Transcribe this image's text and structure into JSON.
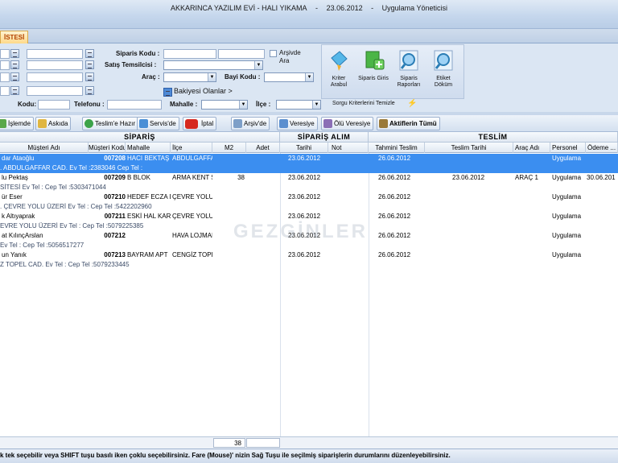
{
  "titlebar": {
    "company": "AKKARINCA YAZILIM EVİ - HALI YIKAMA",
    "sep1": "-",
    "date": "23.06.2012",
    "sep2": "-",
    "user": "Uygulama Yöneticisi"
  },
  "tab": {
    "label": "İSTESİ"
  },
  "filters": {
    "siparis_kodu": "Siparis Kodu :",
    "satis_temsilcisi": "Satış Temsilcisi :",
    "arac": "Araç :",
    "bayi_kodu": "Bayi Kodu :",
    "arsivde_ara": "Arşivde",
    "arsivde_ara2": "Ara",
    "bakiyesi_olanlar": "Bakiyesi Olanlar >",
    "kodu": "Kodu:",
    "telefonu": "Telefonu :",
    "mahalle": "Mahalle :",
    "ilce": "İlçe :",
    "sorgu_temizle": "Sorgu Kriterlerini Temizle"
  },
  "bigbuttons": {
    "kriter": "Kriter Arabul",
    "siparis_giris": "Siparis Giris",
    "siparis_raporlari": "Siparis Raporları",
    "etiket_dokum": "Etiket Döküm"
  },
  "toolbar": {
    "islemde": "İşlemde",
    "askida": "Askıda",
    "teslime_hazir": "Teslim'e Hazır",
    "servisde": "Servis'de",
    "iptal": "İptal",
    "arsivde": "Arşiv'de",
    "veresiye": "Veresiye",
    "olu_veresiye": "Ölü Veresiye",
    "aktiflerin_tumu": "Aktiflerin Tümü"
  },
  "grid": {
    "group_siparis": "SİPARİŞ",
    "group_alim": "SİPARİŞ ALIM",
    "group_teslim": "TESLİM",
    "columns": {
      "musteri_adi": "Müşteri Adı",
      "musteri_kodu": "Müşteri Kodu",
      "mahalle": "Mahalle",
      "ilce": "İlçe",
      "m2": "M2",
      "adet": "Adet",
      "tarih": "Tarihi",
      "not": "Not",
      "tahmini_teslim": "Tahmini Teslim",
      "teslim_tarihi": "Teslim Tarihi",
      "arac_adi": "Araç Adı",
      "personel": "Personel",
      "odeme": "Ödeme ..."
    },
    "rows": [
      {
        "name": "dar Ataoğlu",
        "code": "007208",
        "mahalle": "HACI BEKTAŞ \\",
        "ilce": "ABDULGAFFA",
        "m2": "",
        "adet": "",
        "tarih": "23.06.2012",
        "not": "",
        "tahmini": "26.06.2012",
        "teslim": "",
        "arac": "",
        "personel": "Uygulama",
        "odeme": "",
        "sub": ". ABDULGAFFAR CAD.    Ev Tel :2383046 Cep Tel :"
      },
      {
        "name": "lu Pektaş",
        "code": "007209",
        "mahalle": "B BLOK",
        "ilce": "ARMA KENT S",
        "m2": "38",
        "adet": "",
        "tarih": "23.06.2012",
        "not": "",
        "tahmini": "26.06.2012",
        "teslim": "23.06.2012",
        "arac": "ARAÇ 1",
        "personel": "Uygulama",
        "odeme": "30.06.201",
        "sub": "SİTESİ    Ev Tel : Cep Tel :5303471044"
      },
      {
        "name": "ür Eser",
        "code": "007210",
        "mahalle": "HEDEF ECZA D",
        "ilce": "ÇEVRE YOLU",
        "m2": "",
        "adet": "",
        "tarih": "23.06.2012",
        "not": "",
        "tahmini": "26.06.2012",
        "teslim": "",
        "arac": "",
        "personel": "Uygulama",
        "odeme": "",
        "sub": ". ÇEVRE YOLU ÜZERİ    Ev Tel : Cep Tel :5422202960"
      },
      {
        "name": "k Altıyaprak",
        "code": "007211",
        "mahalle": "ESKİ HAL KARŞ",
        "ilce": "ÇEVRE YOLU",
        "m2": "",
        "adet": "",
        "tarih": "23.06.2012",
        "not": "",
        "tahmini": "26.06.2012",
        "teslim": "",
        "arac": "",
        "personel": "Uygulama",
        "odeme": "",
        "sub": "EVRE YOLU ÜZERİ    Ev Tel : Cep Tel :5079225385"
      },
      {
        "name": "at KılınçArslan",
        "code": "007212",
        "mahalle": "",
        "ilce": "HAVA LOJMAI",
        "m2": "",
        "adet": "",
        "tarih": "23.06.2012",
        "not": "",
        "tahmini": "26.06.2012",
        "teslim": "",
        "arac": "",
        "personel": "Uygulama",
        "odeme": "",
        "sub": "    Ev Tel : Cep Tel :5056517277"
      },
      {
        "name": "un Yanık",
        "code": "007213",
        "mahalle": "BAYRAM APT",
        "ilce": "CENGİZ TOPE",
        "m2": "",
        "adet": "",
        "tarih": "23.06.2012",
        "not": "",
        "tahmini": "26.06.2012",
        "teslim": "",
        "arac": "",
        "personel": "Uygulama",
        "odeme": "",
        "sub": "Z TOPEL CAD.    Ev Tel : Cep Tel :5079233445"
      }
    ],
    "sum_m2": "38"
  },
  "watermark": "GEZGİNLER",
  "statusbar": "k tek seçebilir veya SHIFT tuşu basılı iken çoklu seçebilirsiniz. Fare (Mouse)' nizin Sağ Tuşu ile seçilmiş siparişlerin durumlarını düzenleyebilirsiniz.",
  "colors": {
    "selection": "#3b8ef0",
    "panel": "#dbe6f3",
    "accent_tab": "#b04000"
  }
}
